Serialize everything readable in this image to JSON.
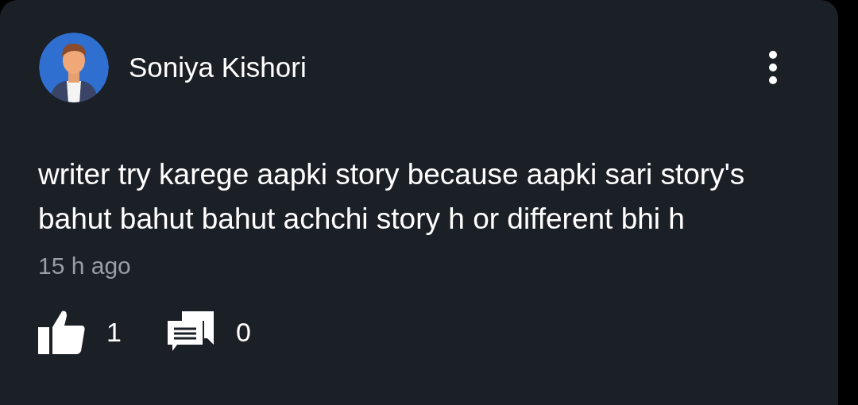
{
  "comment": {
    "author": "Soniya Kishori",
    "text": "writer try karege aapki story because aapki sari story's bahut bahut bahut achchi story h or different bhi h",
    "time": "15 h ago",
    "likes": "1",
    "replies": "0"
  }
}
